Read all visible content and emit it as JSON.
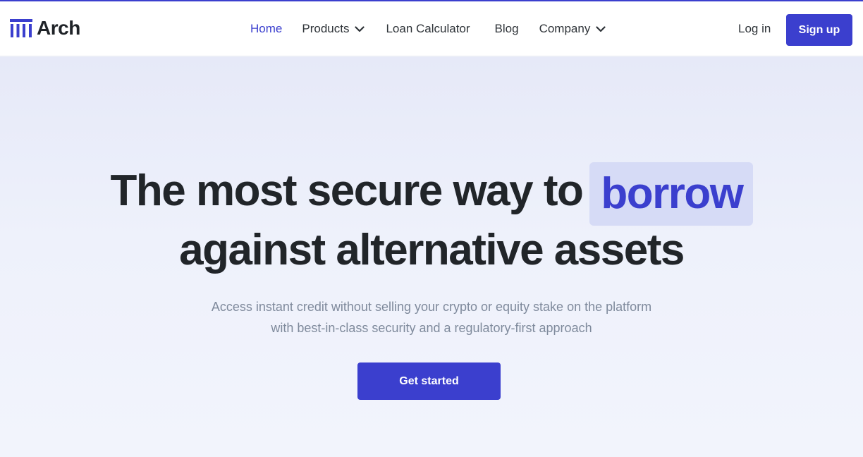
{
  "brand": {
    "name": "Arch",
    "logo_icon": "pillars-logo-icon",
    "accent_color": "#3b3fce"
  },
  "nav": {
    "items": [
      {
        "label": "Home",
        "active": true,
        "has_dropdown": false
      },
      {
        "label": "Products",
        "active": false,
        "has_dropdown": true
      },
      {
        "label": "Loan Calculator",
        "active": false,
        "has_dropdown": false
      },
      {
        "label": "Blog",
        "active": false,
        "has_dropdown": false
      },
      {
        "label": "Company",
        "active": false,
        "has_dropdown": true
      }
    ],
    "dropdown_icon": "chevron-down-icon"
  },
  "auth": {
    "login_label": "Log in",
    "signup_label": "Sign up"
  },
  "hero": {
    "headline_line1_prefix": "The most secure way to",
    "headline_highlight": "borrow",
    "headline_line2": "against alternative assets",
    "subtext_line1": "Access instant credit without selling your crypto or equity stake on the platform",
    "subtext_line2": "with best-in-class security and a regulatory-first approach",
    "cta_label": "Get started"
  }
}
